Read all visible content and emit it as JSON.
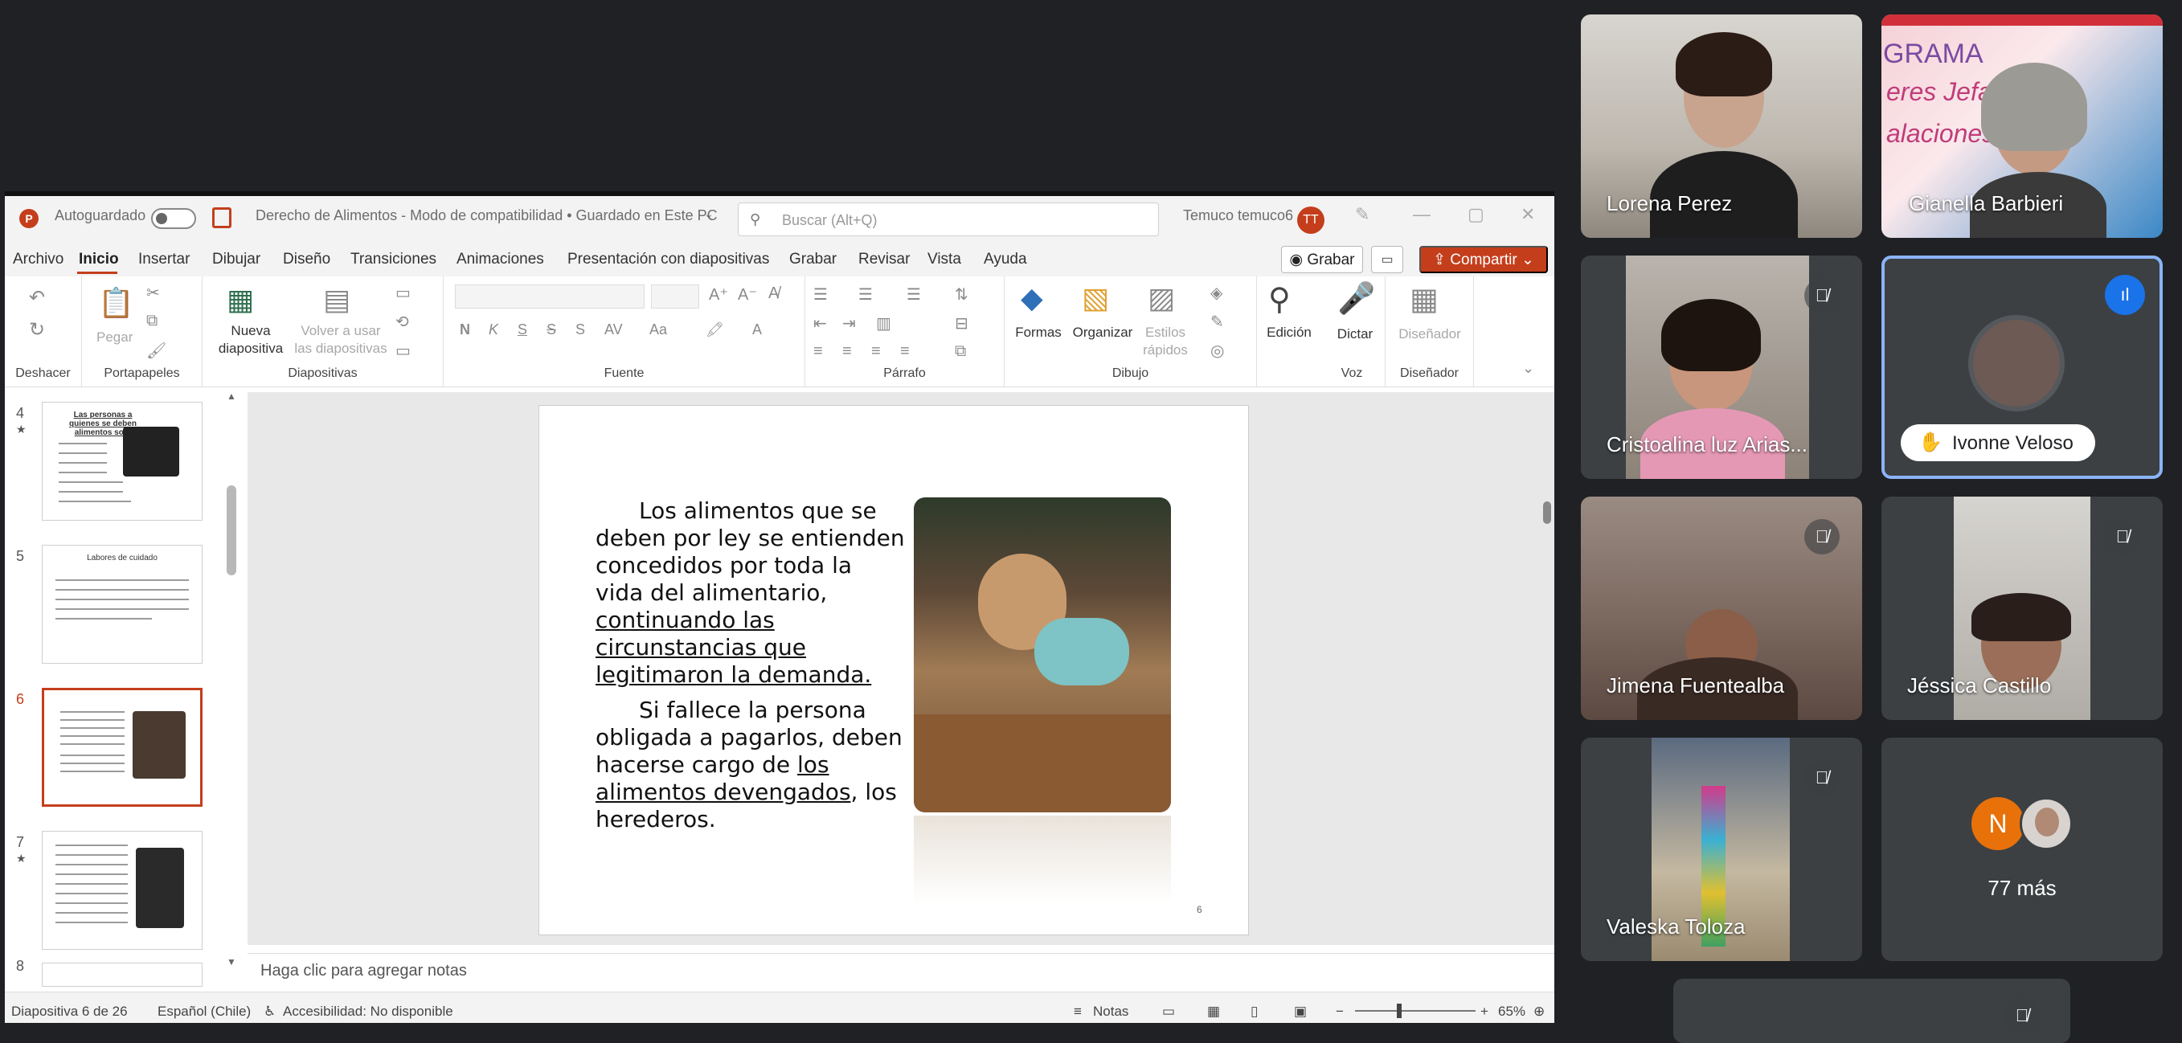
{
  "ppt": {
    "autosave_label": "Autoguardado",
    "doc_title": "Derecho de Alimentos  -  Modo de compatibilidad • Guardado en Este PC",
    "search_placeholder": "Buscar (Alt+Q)",
    "user_name": "Temuco temuco6",
    "user_initials": "TT",
    "menu": [
      "Archivo",
      "Inicio",
      "Insertar",
      "Dibujar",
      "Diseño",
      "Transiciones",
      "Animaciones",
      "Presentación con diapositivas",
      "Grabar",
      "Revisar",
      "Vista",
      "Ayuda"
    ],
    "record_label": "Grabar",
    "share_label": "Compartir",
    "ribbon": {
      "paste": "Pegar",
      "new_slide": "Nueva",
      "new_slide_2": "diapositiva",
      "reuse": "Volver a usar",
      "reuse_2": "las diapositivas",
      "shapes": "Formas",
      "arrange": "Organizar",
      "quick_styles": "Estilos",
      "quick_styles_2": "rápidos",
      "editing": "Edición",
      "dictate": "Dictar",
      "designer": "Diseñador",
      "groups": [
        "Deshacer",
        "Portapapeles",
        "Diapositivas",
        "Fuente",
        "Párrafo",
        "Dibujo",
        "Voz",
        "Diseñador"
      ]
    },
    "thumbnails": [
      {
        "num": "4",
        "title": "Las personas a quienes se deben alimentos son:"
      },
      {
        "num": "5",
        "title": "Labores de cuidado"
      },
      {
        "num": "6",
        "title": ""
      },
      {
        "num": "7",
        "title": ""
      },
      {
        "num": "8",
        "title": ""
      }
    ],
    "slide": {
      "p1_a": "Los alimentos que se",
      "p1_b": "deben por ley se entienden",
      "p1_c": "concedidos por toda la",
      "p1_d": "vida del alimentario,",
      "p1_e": "continuando las",
      "p1_f": "circunstancias que",
      "p1_g": "legitimaron la demanda.",
      "p2_a": "Si fallece la persona",
      "p2_b": "obligada a pagarlos, deben",
      "p2_c_pre": "hacerse cargo de ",
      "p2_c_u": "los",
      "p2_d_u": "alimentos devengados",
      "p2_d_post": ", los",
      "p2_e": "herederos.",
      "number": "6"
    },
    "notes_placeholder": "Haga clic para agregar notas",
    "status": {
      "slide_of": "Diapositiva 6 de 26",
      "language": "Español (Chile)",
      "accessibility": "Accesibilidad: No disponible",
      "notes": "Notas",
      "zoom": "65%"
    }
  },
  "meet": {
    "participants": [
      {
        "name": "Lorena Perez"
      },
      {
        "name": "Gianella Barbieri"
      },
      {
        "name": "Cristoalina luz Arias..."
      },
      {
        "name": "Ivonne Veloso"
      },
      {
        "name": "Jimena Fuentealba"
      },
      {
        "name": "Jéssica Castillo"
      },
      {
        "name": "Valeska Toloza"
      }
    ],
    "more_label": "77 más",
    "more_initial": "N",
    "banner_text": "GRAMA",
    "banner_text_2": "eres Jefas d",
    "banner_text_3": "alaciones o"
  }
}
